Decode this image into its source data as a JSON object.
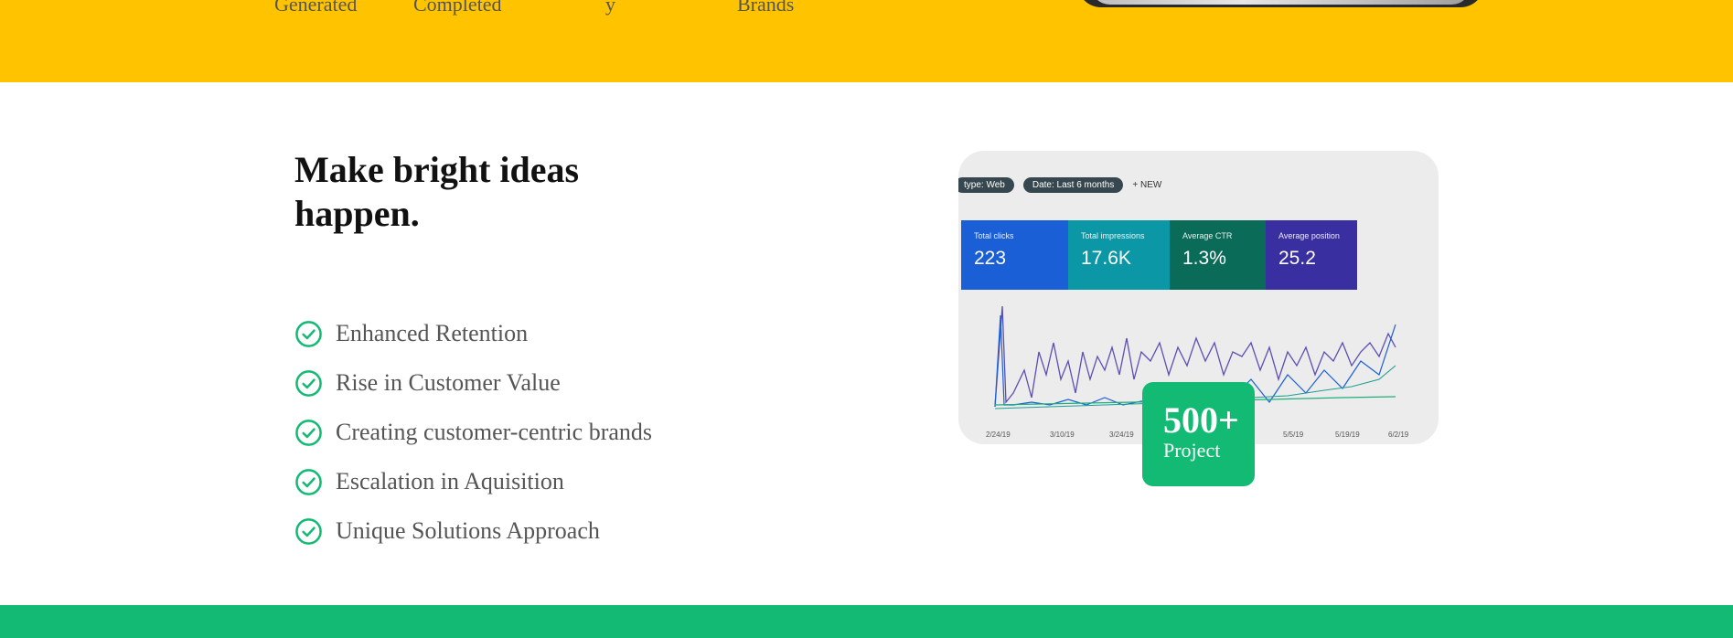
{
  "stats_band": {
    "labels": [
      "Generated",
      "Completed",
      "y",
      "Brands"
    ]
  },
  "content": {
    "heading": "Make bright ideas happen.",
    "features": [
      "Enhanced Retention",
      "Rise in Customer Value",
      "Creating customer-centric brands",
      "Escalation in Aquisition",
      "Unique Solutions Approach"
    ]
  },
  "dashboard": {
    "chips": [
      "type: Web",
      "Date: Last 6 months"
    ],
    "new_label": "NEW",
    "metrics": [
      {
        "label": "Total clicks",
        "value": "223",
        "color": "#1a5fd6"
      },
      {
        "label": "Total impressions",
        "value": "17.6K",
        "color": "#0c97a6"
      },
      {
        "label": "Average CTR",
        "value": "1.3%",
        "color": "#0b6b59"
      },
      {
        "label": "Average position",
        "value": "25.2",
        "color": "#3a2fa0"
      }
    ],
    "dates": [
      "2/24/19",
      "3/10/19",
      "3/24/19",
      "5/5/19",
      "5/19/19",
      "6/2/19"
    ]
  },
  "badge": {
    "number": "500+",
    "label": "Project"
  },
  "colors": {
    "yellow": "#FFC300",
    "green": "#12BA73"
  }
}
